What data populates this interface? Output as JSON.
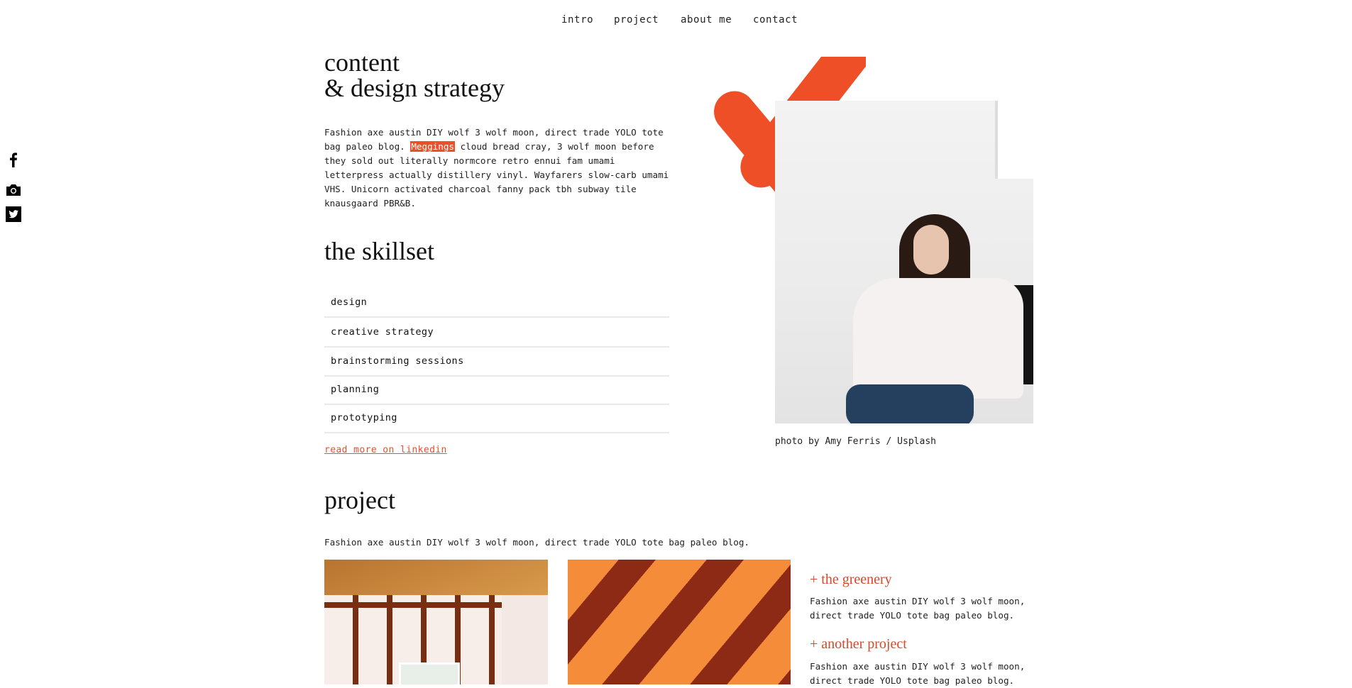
{
  "nav": {
    "items": [
      "intro",
      "project",
      "about me",
      "contact"
    ]
  },
  "social": {
    "icons": [
      "facebook-icon",
      "camera-icon",
      "twitter-icon"
    ]
  },
  "hero": {
    "title_line1": "content",
    "title_line2": "& design strategy",
    "paragraph_before": "Fashion axe austin DIY wolf 3 wolf moon, direct trade YOLO tote bag paleo blog. ",
    "highlight": "Meggings",
    "paragraph_after": " cloud bread cray, 3 wolf moon before they sold out literally normcore retro ennui fam umami letterpress actually distillery vinyl. Wayfarers slow-carb umami VHS. Unicorn activated charcoal fanny pack tbh subway tile knausgaard PBR&B."
  },
  "skillset": {
    "title": "the skillset",
    "items": [
      "design",
      "creative strategy",
      "brainstorming sessions",
      "planning",
      "prototyping"
    ],
    "link": "read more on linkedin"
  },
  "photo": {
    "caption": "photo by Amy Ferris / Usplash"
  },
  "project": {
    "title": "project",
    "intro": "Fashion axe austin DIY wolf 3 wolf moon, direct trade YOLO tote bag paleo blog.",
    "entries": [
      {
        "title": "+ the greenery",
        "text": "Fashion axe austin DIY wolf 3 wolf moon, direct trade YOLO tote bag paleo blog."
      },
      {
        "title": "+ another project",
        "text": "Fashion axe austin DIY wolf 3 wolf moon, direct trade YOLO tote bag paleo blog."
      }
    ]
  },
  "colors": {
    "accent": "#ef4f26",
    "text": "#111111",
    "divider": "#e9e9e9"
  }
}
